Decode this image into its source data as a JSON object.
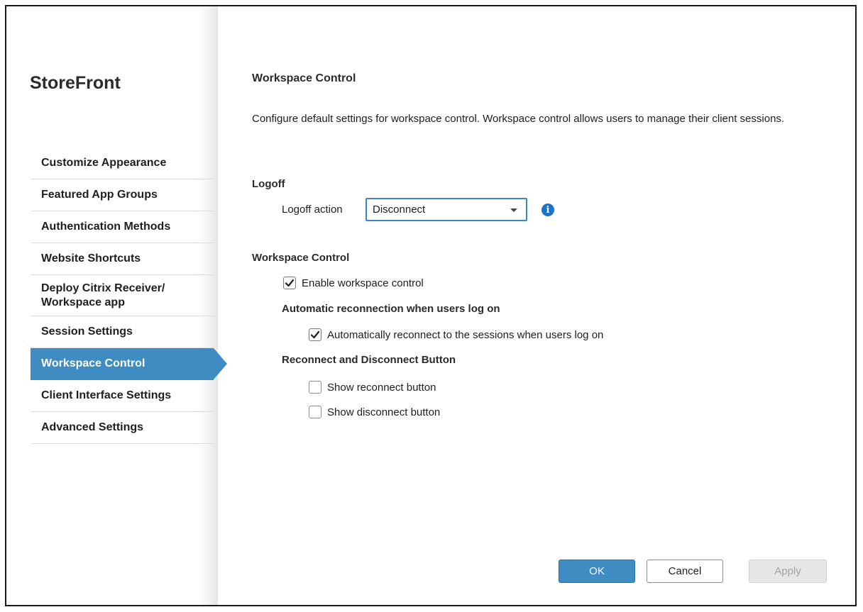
{
  "sidebar": {
    "brand": "StoreFront",
    "items": [
      {
        "label": "Customize Appearance"
      },
      {
        "label": "Featured App Groups"
      },
      {
        "label": "Authentication Methods"
      },
      {
        "label": "Website Shortcuts"
      },
      {
        "label": "Deploy Citrix Receiver/ Workspace app"
      },
      {
        "label": "Session Settings"
      },
      {
        "label": "Workspace Control",
        "active": true
      },
      {
        "label": "Client Interface Settings"
      },
      {
        "label": "Advanced Settings"
      }
    ]
  },
  "main": {
    "title": "Workspace Control",
    "description": "Configure default settings for workspace control. Workspace control allows users to manage their client sessions.",
    "logoff": {
      "section_title": "Logoff",
      "action_label": "Logoff action",
      "action_value": "Disconnect"
    },
    "workspace_control": {
      "section_title": "Workspace Control",
      "enable_label": "Enable workspace control",
      "enable_checked": true,
      "auto_reconnect_title": "Automatic reconnection when users log on",
      "auto_reconnect_label": "Automatically reconnect to the sessions when users log on",
      "auto_reconnect_checked": true,
      "buttons_title": "Reconnect and Disconnect Button",
      "show_reconnect_label": "Show reconnect button",
      "show_reconnect_checked": false,
      "show_disconnect_label": "Show disconnect button",
      "show_disconnect_checked": false
    }
  },
  "footer": {
    "ok_label": "OK",
    "cancel_label": "Cancel",
    "apply_label": "Apply"
  },
  "colors": {
    "accent": "#3f8cc3",
    "info_icon": "#1a73c9"
  },
  "icons": [
    "info-icon",
    "checkmark-icon",
    "chevron-down-icon"
  ]
}
